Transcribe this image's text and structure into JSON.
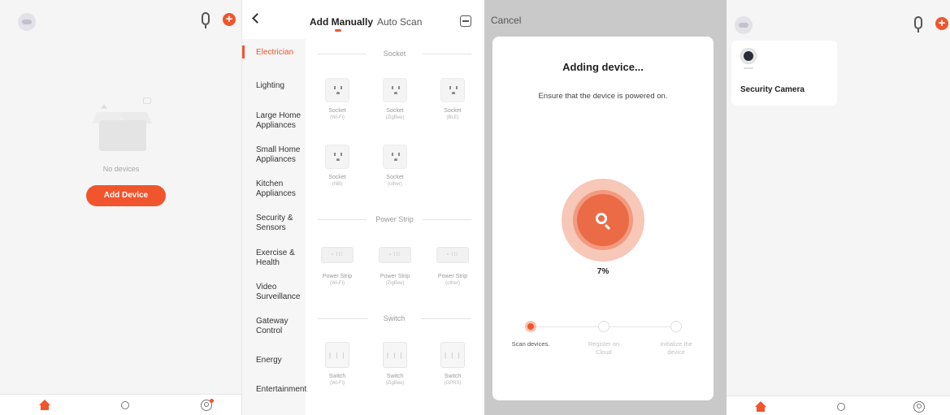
{
  "home_empty": {
    "empty_text": "No devices",
    "add_button": "Add Device",
    "tabs": [
      "Home",
      "Smart",
      "Me"
    ]
  },
  "add_device": {
    "tabs": [
      "Add Manually",
      "Auto Scan"
    ],
    "active_tab": "Add Manually",
    "categories": [
      "Electrician",
      "Lighting",
      "Large Home Appliances",
      "Small Home Appliances",
      "Kitchen Appliances",
      "Security & Sensors",
      "Exercise & Health",
      "Video Surveillance",
      "Gateway Control",
      "Energy",
      "Entertainment"
    ],
    "active_category": "Electrician",
    "sections": [
      {
        "title": "Socket",
        "devices": [
          {
            "name": "Socket",
            "sub": "(Wi-Fi)"
          },
          {
            "name": "Socket",
            "sub": "(ZigBee)"
          },
          {
            "name": "Socket",
            "sub": "(BLE)"
          },
          {
            "name": "Socket",
            "sub": "(NB)"
          },
          {
            "name": "Socket",
            "sub": "(other)"
          }
        ]
      },
      {
        "title": "Power Strip",
        "devices": [
          {
            "name": "Power Strip",
            "sub": "(Wi-Fi)"
          },
          {
            "name": "Power Strip",
            "sub": "(ZigBee)"
          },
          {
            "name": "Power Strip",
            "sub": "(other)"
          }
        ]
      },
      {
        "title": "Switch",
        "devices": [
          {
            "name": "Switch",
            "sub": "(Wi-Fi)"
          },
          {
            "name": "Switch",
            "sub": "(ZigBee)"
          },
          {
            "name": "Switch",
            "sub": "(GPRS)"
          }
        ]
      }
    ]
  },
  "adding": {
    "cancel": "Cancel",
    "title": "Adding device...",
    "subtitle": "Ensure that the device is powered on.",
    "progress_percent": "7%",
    "progress": 0.07,
    "steps": [
      {
        "label": "Scan devices.",
        "active": true
      },
      {
        "label": "Register on Cloud",
        "active": false
      },
      {
        "label": "Initialize the device",
        "active": false
      }
    ]
  },
  "home_device": {
    "device_name": "Security Camera",
    "tabs": [
      "Home",
      "Smart",
      "Me"
    ]
  },
  "colors": {
    "accent": "#f0552d",
    "ring_light": "#f7c7b8"
  }
}
